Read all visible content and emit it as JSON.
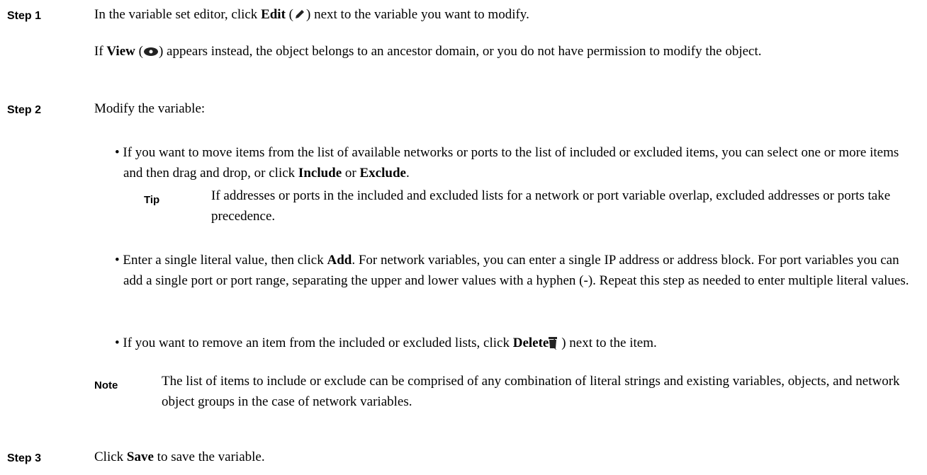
{
  "step1": {
    "label": "Step 1",
    "line_a": "In the variable set editor, click ",
    "edit": "Edit",
    "line_b": " next to the variable you want to modify.",
    "p2_view": "View",
    "p2_rest": " appears instead, the object belongs to an ancestor domain, or you do not have permission to modify the object.",
    "p2_if": "If "
  },
  "step2": {
    "label": "Step 2",
    "intro": "Modify the variable:",
    "b1_a": "If you want to move items from the list of available networks or ports to the list of included or excluded items, you can select one or more items and then drag and drop, or click ",
    "b1_include": "Include",
    "b1_or": " or ",
    "b1_exclude": "Exclude",
    "b1_end": ".",
    "tip_label": "Tip",
    "tip_text": "If addresses or ports in the included and excluded lists for a network or port variable overlap, excluded addresses or ports take precedence.",
    "b2_a": "Enter a single literal value, then click ",
    "b2_add": "Add",
    "b2_b": ". For network variables, you can enter a single IP address or address block. For port variables you can add a single port or port range, separating the upper and lower values with a hyphen (-). Repeat this step as needed to enter multiple literal values.",
    "b3_a": "If you want to remove an item from the included or excluded lists, click ",
    "b3_delete": "Delete",
    "b3_b": " next to the item.",
    "note_label": "Note",
    "note_text": "The list of items to include or exclude can be comprised of any combination of literal strings and existing variables, objects, and network object groups in the case of network variables."
  },
  "step3": {
    "label": "Step 3",
    "a": "Click ",
    "save": "Save",
    "b": " to save the variable."
  },
  "icons": {
    "edit": "pencil-icon",
    "view": "eye-icon",
    "delete": "trash-icon"
  },
  "bullet_char": "•"
}
